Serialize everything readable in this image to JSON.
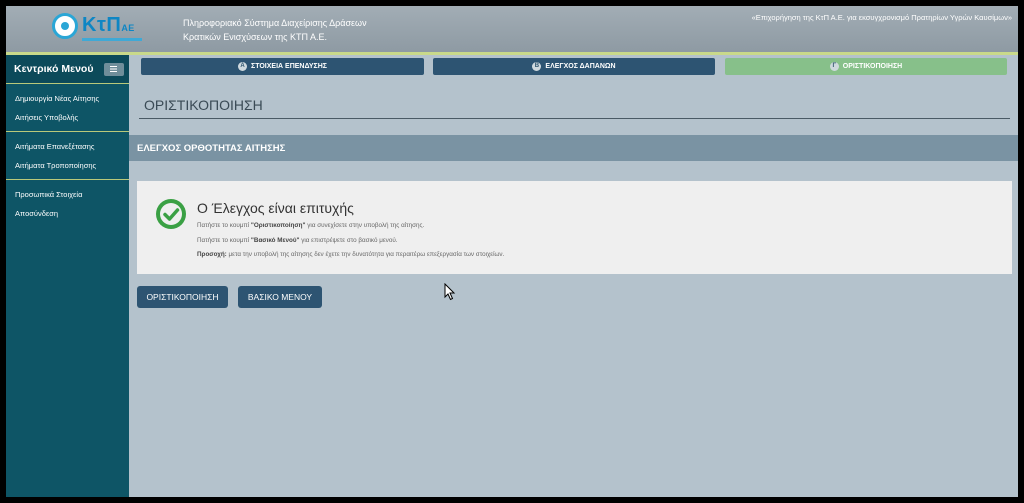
{
  "header": {
    "logo_text": "ΚτΠ",
    "logo_suffix": "ΑΕ",
    "title_line1": "Πληροφοριακό Σύστημα Διαχείρισης Δράσεων",
    "title_line2": "Κρατικών Ενισχύσεων της ΚΤΠ Α.Ε.",
    "program": "«Επιχορήγηση της ΚτΠ Α.Ε. για εκσυγχρονισμό Πρατηρίων Υγρών Καυσίμων»"
  },
  "sidebar": {
    "title": "Κεντρικό Μενού",
    "groups": [
      [
        "Δημιουργία Νέας Αίτησης",
        "Αιτήσεις Υποβολής"
      ],
      [
        "Αιτήματα Επανεξέτασης",
        "Αιτήματα Τροποποίησης"
      ],
      [
        "Προσωπικά Στοιχεία",
        "Αποσύνδεση"
      ]
    ]
  },
  "steps": [
    {
      "num": "A",
      "label": "ΣΤΟΙΧΕΙΑ ΕΠΕΝΔΥΣΗΣ"
    },
    {
      "num": "B",
      "label": "ΕΛΕΓΧΟΣ ΔΑΠΑΝΩΝ"
    },
    {
      "num": "Γ",
      "label": "ΟΡΙΣΤΙΚΟΠΟΙΗΣΗ"
    }
  ],
  "page_title": "ΟΡΙΣΤΙΚΟΠΟΙΗΣΗ",
  "section_title": "ΕΛΕΓΧΟΣ ΟΡΘΟΤΗΤΑΣ ΑΙΤΗΣΗΣ",
  "panel": {
    "heading": "Ο Έλεγχος είναι επιτυχής",
    "line1_pre": "Πατήστε το κουμπί ",
    "line1_bold": "\"Οριστικοποίηση\"",
    "line1_post": " για συνεχίσετε στην υποβολή της αίτησης.",
    "line2_pre": "Πατήστε το κουμπί ",
    "line2_bold": "\"Βασικό Μενού\"",
    "line2_post": " για επιστρέψετε στο βασικό μενού.",
    "line3_bold": "Προσοχή:",
    "line3_post": " μετα την υποβολή της αίτησης δεν έχετε την δυνατότητα για περαιτέρω επεξεργασία των στοιχείων."
  },
  "buttons": {
    "finalize": "ΟΡΙΣΤΙΚΟΠΟΙΗΣΗ",
    "main_menu": "ΒΑΣΙΚΟ ΜΕΝΟΥ"
  },
  "colors": {
    "accent": "#2d5472",
    "sidebar": "#0e5566",
    "success": "#3aa044",
    "step_active": "#87c08a"
  }
}
